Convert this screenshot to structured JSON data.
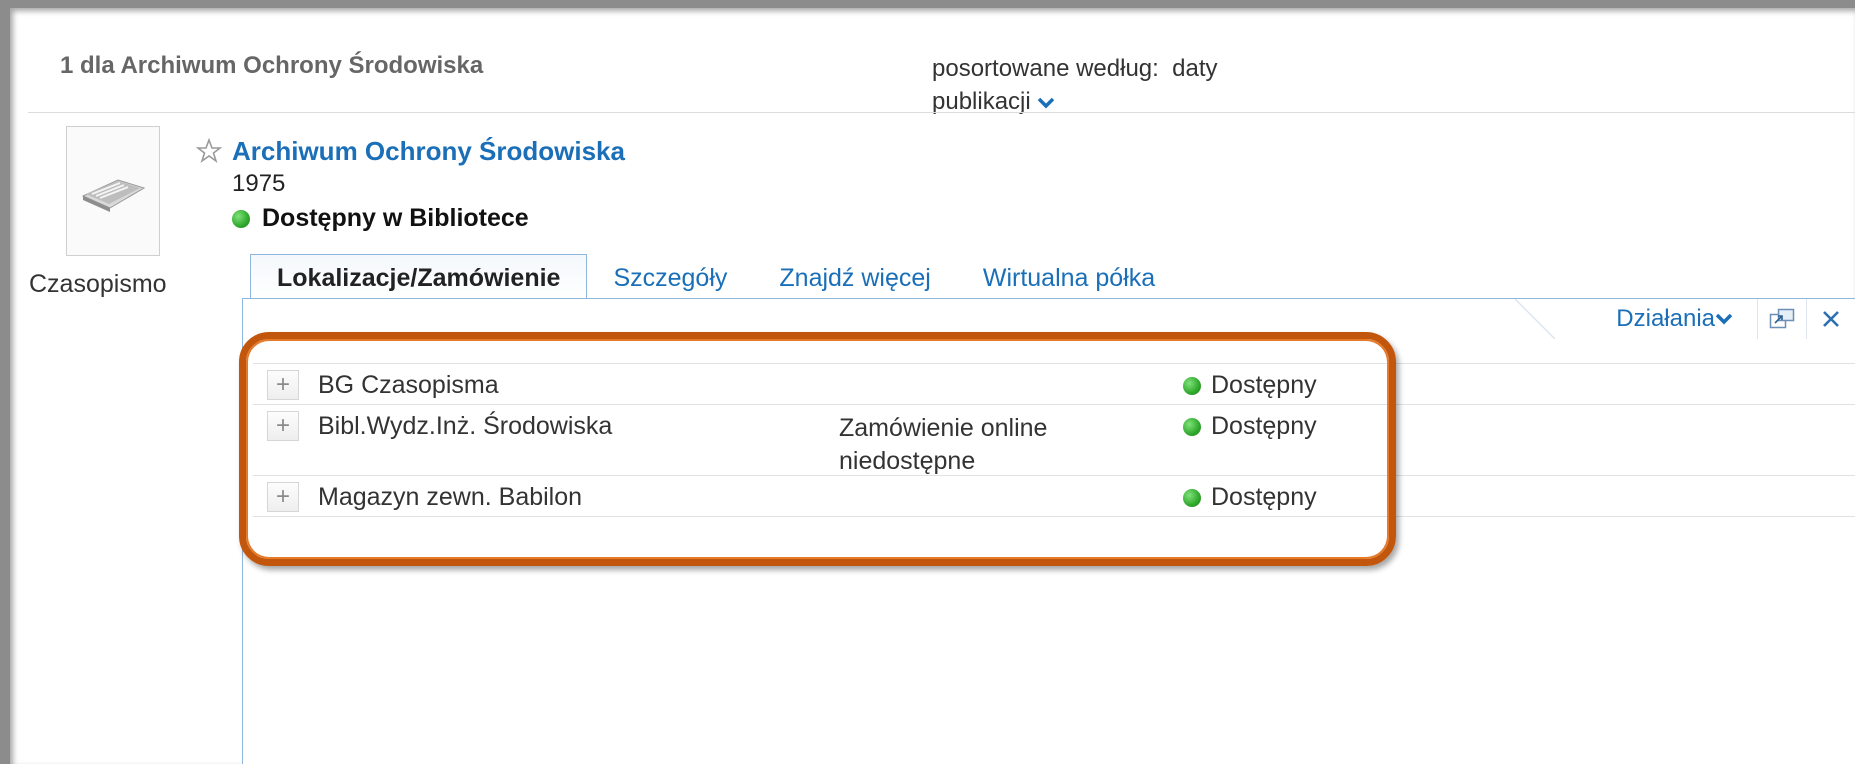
{
  "results_header": {
    "count_text": "1 dla Archiwum Ochrony Środowiska",
    "sort_label": "posortowane według:",
    "sort_value": "daty publikacji"
  },
  "record": {
    "thumbnail_caption": "Czasopismo",
    "title": "Archiwum Ochrony Środowiska",
    "year": "1975",
    "availability": "Dostępny w Bibliotece",
    "availability_color": "#2fa82c"
  },
  "tabs": [
    {
      "label": "Lokalizacje/Zamówienie",
      "active": true
    },
    {
      "label": "Szczegóły",
      "active": false
    },
    {
      "label": "Znajdź więcej",
      "active": false
    },
    {
      "label": "Wirtualna półka",
      "active": false
    }
  ],
  "panel_toolbar": {
    "actions_label": "Działania",
    "icons": [
      "popout-icon",
      "close-icon"
    ]
  },
  "locations": [
    {
      "name": "BG Czasopisma",
      "note": "",
      "status": "Dostępny"
    },
    {
      "name": "Bibl.Wydz.Inż. Środowiska",
      "note": "Zamówienie online niedostępne",
      "status": "Dostępny"
    },
    {
      "name": "Magazyn zewn. Babilon",
      "note": "",
      "status": "Dostępny"
    }
  ],
  "colors": {
    "link": "#1a6fb8",
    "highlight_border": "#c2560c",
    "status_green": "#2fa82c"
  }
}
